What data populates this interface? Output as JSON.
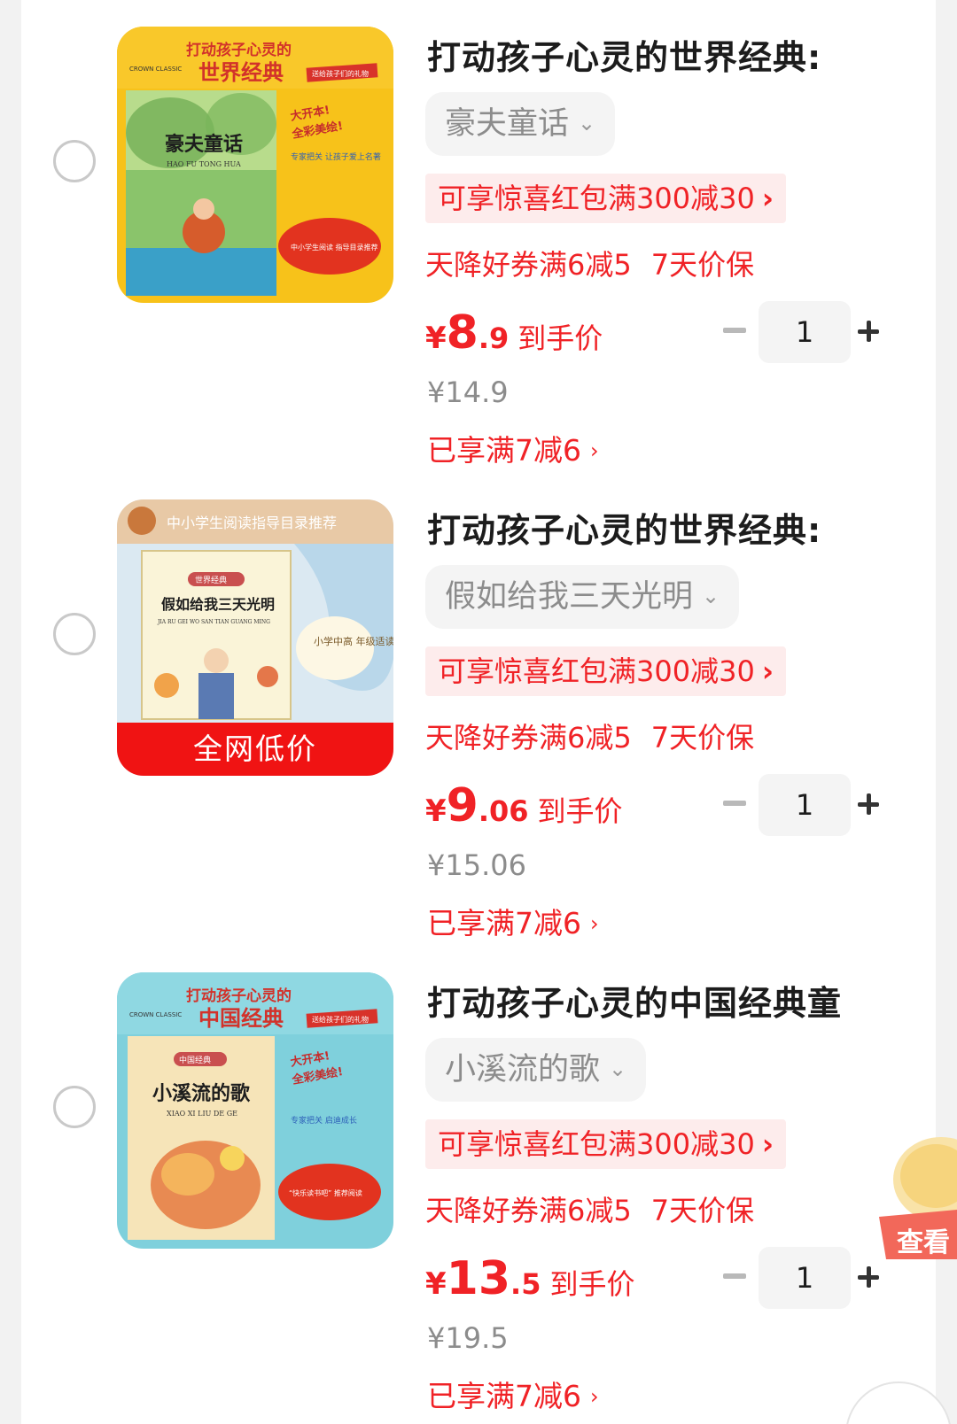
{
  "items": [
    {
      "title": "打动孩子心灵的世界经典:",
      "sku": "豪夫童话",
      "promo": "可享惊喜红包满300减30",
      "coupon": "天降好券满6减5",
      "guarantee": "7天价保",
      "price_int": "8",
      "price_dec": ".9",
      "price_label": "到手价",
      "yen": "¥",
      "original_price": "¥14.9",
      "enjoyed": "已享满7减6",
      "quantity": "1",
      "cover": {
        "top_title": "打动孩子心灵的",
        "big_title": "世界经典",
        "book_title": "豪夫童话",
        "book_pinyin": "HAO FU TONG HUA",
        "brand": "CROWN CLASSIC",
        "slogan1": "大开本!",
        "slogan2": "全彩美绘!",
        "note": "专家把关 让孩子爱上名著",
        "bubble": "中小学生阅读 指导目录推荐",
        "ribbon": "送给孩子们的礼物"
      }
    },
    {
      "title": "打动孩子心灵的世界经典:",
      "sku": "假如给我三天光明",
      "promo": "可享惊喜红包满300减30",
      "coupon": "天降好券满6减5",
      "guarantee": "7天价保",
      "price_int": "9",
      "price_dec": ".06",
      "price_label": "到手价",
      "yen": "¥",
      "original_price": "¥15.06",
      "enjoyed": "已享满7减6",
      "quantity": "1",
      "cover": {
        "header": "中小学生阅读指导目录推荐",
        "book_title": "假如给我三天光明",
        "book_pinyin": "JIA RU GEI WO SAN TIAN GUANG MING",
        "series": "世界经典",
        "bubble": "小学中高 年级适读",
        "badge": "全网低价"
      }
    },
    {
      "title": "打动孩子心灵的中国经典童",
      "sku": "小溪流的歌",
      "promo": "可享惊喜红包满300减30",
      "coupon": "天降好券满6减5",
      "guarantee": "7天价保",
      "price_int": "13",
      "price_dec": ".5",
      "price_label": "到手价",
      "yen": "¥",
      "original_price": "¥19.5",
      "enjoyed": "已享满7减6",
      "quantity": "1",
      "cover": {
        "top_title": "打动孩子心灵的",
        "big_title": "中国经典",
        "book_title": "小溪流的歌",
        "book_pinyin": "XIAO XI LIU DE GE",
        "brand": "CROWN CLASSIC",
        "slogan1": "大开本!",
        "slogan2": "全彩美绘!",
        "note": "专家把关 启迪成长",
        "bubble": "“快乐读书吧” 推荐阅读",
        "ribbon": "送给孩子们的礼物"
      }
    }
  ],
  "floating_button": {
    "label": "查看"
  },
  "colors": {
    "accent": "#f02226",
    "promo_bg": "#fdecec",
    "sku_bg": "#f4f4f4"
  }
}
